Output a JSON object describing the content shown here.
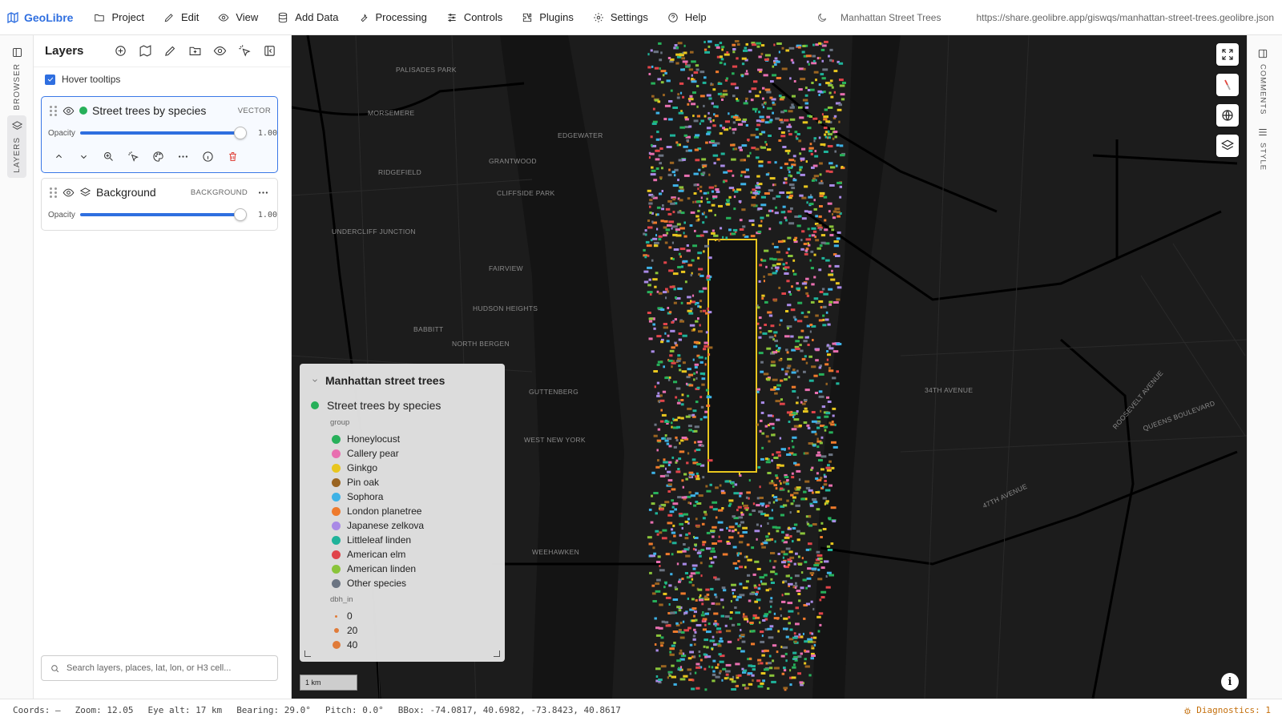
{
  "app": {
    "name": "GeoLibre",
    "project_name": "Manhattan Street Trees",
    "share_url": "https://share.geolibre.app/giswqs/manhattan-street-trees.geolibre.json"
  },
  "menu": [
    {
      "label": "Project",
      "icon": "folder-icon"
    },
    {
      "label": "Edit",
      "icon": "pencil-icon"
    },
    {
      "label": "View",
      "icon": "eye-icon"
    },
    {
      "label": "Add Data",
      "icon": "database-icon"
    },
    {
      "label": "Processing",
      "icon": "wrench-icon"
    },
    {
      "label": "Controls",
      "icon": "sliders-icon"
    },
    {
      "label": "Plugins",
      "icon": "puzzle-icon"
    },
    {
      "label": "Settings",
      "icon": "gear-icon"
    },
    {
      "label": "Help",
      "icon": "help-icon"
    }
  ],
  "left_rail": {
    "browser_label": "BROWSER",
    "layers_label": "LAYERS"
  },
  "right_rail": {
    "comments_label": "COMMENTS",
    "style_label": "STYLE"
  },
  "layers_panel": {
    "title": "Layers",
    "hover_tooltips_label": "Hover tooltips",
    "hover_tooltips_checked": true,
    "layers": [
      {
        "name": "Street trees by species",
        "type": "VECTOR",
        "opacity_label": "Opacity",
        "opacity": "1.00",
        "color": "#27b05a",
        "selected": true
      },
      {
        "name": "Background",
        "type": "BACKGROUND",
        "opacity_label": "Opacity",
        "opacity": "1.00",
        "selected": false
      }
    ],
    "search_placeholder": "Search layers, places, lat, lon, or H3 cell..."
  },
  "legend": {
    "title": "Manhattan street trees",
    "layer_name": "Street trees by species",
    "group_label": "group",
    "items": [
      {
        "label": "Honeylocust",
        "color": "#27b05a"
      },
      {
        "label": "Callery pear",
        "color": "#e86fb0"
      },
      {
        "label": "Ginkgo",
        "color": "#e8c61e"
      },
      {
        "label": "Pin oak",
        "color": "#9a6421"
      },
      {
        "label": "Sophora",
        "color": "#3eb2e6"
      },
      {
        "label": "London planetree",
        "color": "#ee7a2c"
      },
      {
        "label": "Japanese zelkova",
        "color": "#a98ae6"
      },
      {
        "label": "Littleleaf linden",
        "color": "#1fb39a"
      },
      {
        "label": "American elm",
        "color": "#e0444a"
      },
      {
        "label": "American linden",
        "color": "#8ac43a"
      },
      {
        "label": "Other species",
        "color": "#6b7482"
      }
    ],
    "size_label": "dbh_in",
    "sizes": [
      "0",
      "20",
      "40"
    ]
  },
  "map": {
    "scale_label": "1 km",
    "place_labels": [
      "PALISADES PARK",
      "MORSEMERE",
      "RIDGEFIELD",
      "GRANTWOOD",
      "EDGEWATER",
      "CLIFFSIDE PARK",
      "UNDERCLIFF JUNCTION",
      "FAIRVIEW",
      "HUDSON HEIGHTS",
      "BABBITT",
      "NORTH BERGEN",
      "GUTTENBERG",
      "WEST NEW YORK",
      "WEEHAWKEN",
      "34TH AVENUE",
      "QUEENS BOULEVARD",
      "47TH AVENUE",
      "ROOSEVELT AVENUE"
    ]
  },
  "status": {
    "coords": "Coords: —",
    "zoom": "Zoom: 12.05",
    "eye_alt": "Eye alt: 17 km",
    "bearing": "Bearing: 29.0°",
    "pitch": "Pitch: 0.0°",
    "bbox": "BBox: -74.0817, 40.6982, -73.8423, 40.8617",
    "diagnostics": "Diagnostics: 1"
  }
}
